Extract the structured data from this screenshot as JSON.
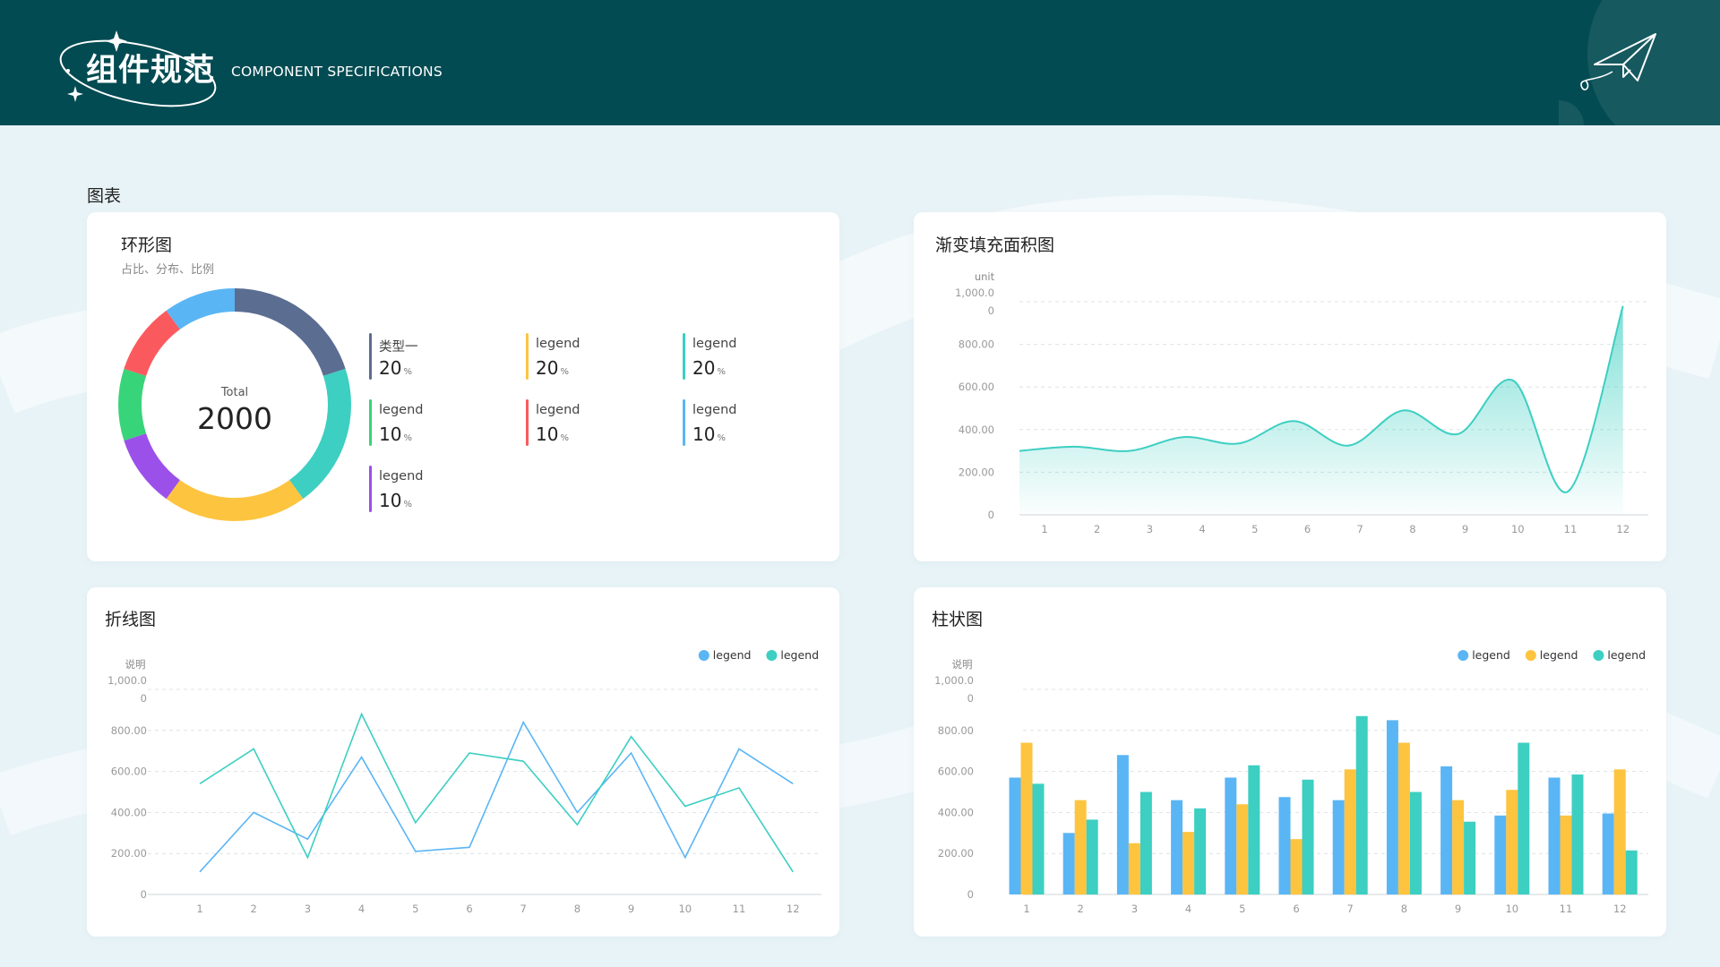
{
  "header": {
    "logo_text": "组件规范",
    "subtitle": "COMPONENT SPECIFICATIONS"
  },
  "section": {
    "title": "图表"
  },
  "colors": {
    "header_bg": "#034b52",
    "teal": "#3ccfc2",
    "blue": "#5ab5f5",
    "yellow": "#fdc43f"
  },
  "donut": {
    "title": "环形图",
    "desc": "占比、分布、比例",
    "center_label": "Total",
    "center_value": "2000",
    "unit": "%",
    "legend": [
      {
        "label": "类型一",
        "value": "20",
        "color": "#5c6d92"
      },
      {
        "label": "legend",
        "value": "20",
        "color": "#fdc43f"
      },
      {
        "label": "legend",
        "value": "20",
        "color": "#3ccfc2"
      },
      {
        "label": "legend",
        "value": "10",
        "color": "#38d47a"
      },
      {
        "label": "legend",
        "value": "10",
        "color": "#fa5a5e"
      },
      {
        "label": "legend",
        "value": "10",
        "color": "#5ab5f5"
      },
      {
        "label": "legend",
        "value": "10",
        "color": "#9b50ea"
      }
    ]
  },
  "area": {
    "title": "渐变填充面积图"
  },
  "line": {
    "title": "折线图"
  },
  "bar": {
    "title": "柱状图"
  },
  "chart_data": [
    {
      "type": "pie",
      "title": "环形图",
      "subtitle": "占比、分布、比例",
      "total": 2000,
      "slices": [
        {
          "label": "类型一",
          "value": 20,
          "color": "#5c6d92"
        },
        {
          "label": "legend",
          "value": 20,
          "color": "#3ccfc2"
        },
        {
          "label": "legend",
          "value": 20,
          "color": "#fdc43f"
        },
        {
          "label": "legend",
          "value": 10,
          "color": "#9b50ea"
        },
        {
          "label": "legend",
          "value": 10,
          "color": "#38d47a"
        },
        {
          "label": "legend",
          "value": 10,
          "color": "#fa5a5e"
        },
        {
          "label": "legend",
          "value": 10,
          "color": "#5ab5f5"
        }
      ]
    },
    {
      "type": "area",
      "title": "渐变填充面积图",
      "ylabel": "unit",
      "ylim": [
        0,
        1000
      ],
      "yticks": [
        "0",
        "200.00",
        "400.00",
        "600.00",
        "800.00",
        "1,000.00"
      ],
      "categories": [
        "1",
        "2",
        "3",
        "4",
        "5",
        "6",
        "7",
        "8",
        "9",
        "10",
        "11",
        "12"
      ],
      "series": [
        {
          "values": [
            300,
            320,
            300,
            365,
            335,
            440,
            325,
            490,
            380,
            630,
            110,
            980
          ],
          "color": "#3ccfc2"
        }
      ]
    },
    {
      "type": "line",
      "title": "折线图",
      "ylabel": "说明",
      "ylim": [
        0,
        1000
      ],
      "yticks": [
        "0",
        "200.00",
        "400.00",
        "600.00",
        "800.00",
        "1,000.00"
      ],
      "categories": [
        "1",
        "2",
        "3",
        "4",
        "5",
        "6",
        "7",
        "8",
        "9",
        "10",
        "11",
        "12"
      ],
      "legend_position": "top-right",
      "series": [
        {
          "name": "legend",
          "color": "#5ab5f5",
          "values": [
            110,
            400,
            270,
            670,
            210,
            230,
            840,
            400,
            690,
            180,
            710,
            540
          ]
        },
        {
          "name": "legend",
          "color": "#3ccfc2",
          "values": [
            540,
            710,
            180,
            880,
            350,
            690,
            650,
            340,
            770,
            430,
            520,
            110
          ]
        }
      ]
    },
    {
      "type": "bar",
      "title": "柱状图",
      "ylabel": "说明",
      "ylim": [
        0,
        1000
      ],
      "yticks": [
        "0",
        "200.00",
        "400.00",
        "600.00",
        "800.00",
        "1,000.00"
      ],
      "categories": [
        "1",
        "2",
        "3",
        "4",
        "5",
        "6",
        "7",
        "8",
        "9",
        "10",
        "11",
        "12"
      ],
      "legend_position": "top-right",
      "series": [
        {
          "name": "legend",
          "color": "#5ab5f5",
          "values": [
            570,
            300,
            680,
            460,
            570,
            475,
            460,
            850,
            625,
            385,
            570,
            395
          ]
        },
        {
          "name": "legend",
          "color": "#fdc43f",
          "values": [
            740,
            460,
            250,
            305,
            440,
            270,
            610,
            740,
            460,
            510,
            385,
            610
          ]
        },
        {
          "name": "legend",
          "color": "#3ccfc2",
          "values": [
            540,
            365,
            500,
            420,
            630,
            560,
            870,
            500,
            355,
            740,
            585,
            215
          ]
        }
      ]
    }
  ]
}
